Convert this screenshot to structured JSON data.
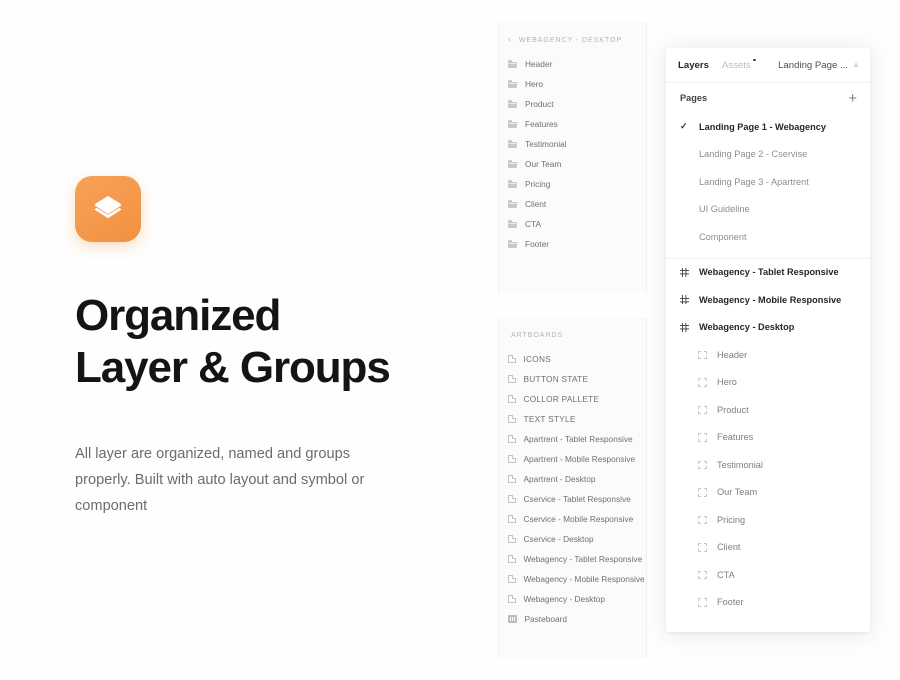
{
  "hero": {
    "logo_icon": "layers-stack-icon",
    "accent_color": "#F2913F",
    "title_line1": "Organized",
    "title_line2": "Layer & Groups",
    "body": "All layer are organized, named and groups properly. Built with auto layout and symbol or component"
  },
  "layers_panel": {
    "back_icon": "chevron-left-icon",
    "header": "WEBAGENCY - DESKTOP",
    "items": [
      {
        "label": "Header",
        "icon": "folder-icon"
      },
      {
        "label": "Hero",
        "icon": "folder-icon"
      },
      {
        "label": "Product",
        "icon": "folder-icon"
      },
      {
        "label": "Features",
        "icon": "folder-icon"
      },
      {
        "label": "Testimonial",
        "icon": "folder-icon"
      },
      {
        "label": "Our Team",
        "icon": "folder-icon"
      },
      {
        "label": "Pricing",
        "icon": "folder-icon"
      },
      {
        "label": "Client",
        "icon": "folder-icon"
      },
      {
        "label": "CTA",
        "icon": "folder-icon"
      },
      {
        "label": "Footer",
        "icon": "folder-icon"
      }
    ]
  },
  "artboards_panel": {
    "header": "ARTBOARDS",
    "items": [
      {
        "label": "ICONS",
        "icon": "artboard-icon",
        "caps": true
      },
      {
        "label": "BUTTON STATE",
        "icon": "artboard-icon",
        "caps": true
      },
      {
        "label": "COLLOR PALLETE",
        "icon": "artboard-icon",
        "caps": true
      },
      {
        "label": "TEXT STYLE",
        "icon": "artboard-icon",
        "caps": true
      },
      {
        "label": "Apartrent - Tablet Responsive",
        "icon": "artboard-icon",
        "caps": false
      },
      {
        "label": "Apartrent - Mobile Responsive",
        "icon": "artboard-icon",
        "caps": false
      },
      {
        "label": "Apartrent - Desktop",
        "icon": "artboard-icon",
        "caps": false
      },
      {
        "label": "Cservice - Tablet Responsive",
        "icon": "artboard-icon",
        "caps": false
      },
      {
        "label": "Cservice - Mobile Responsive",
        "icon": "artboard-icon",
        "caps": false
      },
      {
        "label": "Cservice - Desktop",
        "icon": "artboard-icon",
        "caps": false
      },
      {
        "label": "Webagency - Tablet Responsive",
        "icon": "artboard-icon",
        "caps": false
      },
      {
        "label": "Webagency - Mobile Responsive",
        "icon": "artboard-icon",
        "caps": false
      },
      {
        "label": "Webagency - Desktop",
        "icon": "artboard-icon",
        "caps": false
      },
      {
        "label": "Pasteboard",
        "icon": "pasteboard-icon",
        "caps": false
      }
    ]
  },
  "inspector": {
    "tabs": [
      {
        "label": "Layers",
        "active": true,
        "badge": false
      },
      {
        "label": "Assets",
        "active": false,
        "badge": true
      }
    ],
    "document_selector": {
      "label": "Landing Page ...",
      "caret_icon": "chevron-up-icon"
    },
    "pages_section": {
      "title": "Pages",
      "add_icon": "plus-icon",
      "check_icon": "check-icon",
      "items": [
        {
          "label": "Landing Page 1 - Webagency",
          "selected": true
        },
        {
          "label": "Landing Page 2 - Cservise",
          "selected": false
        },
        {
          "label": "Landing Page 3 - Apartrent",
          "selected": false
        },
        {
          "label": "UI Guideline",
          "selected": false
        },
        {
          "label": "Component",
          "selected": false
        }
      ]
    },
    "layers_section": {
      "artboards": [
        {
          "label": "Webagency - Tablet Responsive",
          "icon": "hash-artboard-icon"
        },
        {
          "label": "Webagency - Mobile Responsive",
          "icon": "hash-artboard-icon"
        },
        {
          "label": "Webagency - Desktop",
          "icon": "hash-artboard-icon"
        }
      ],
      "children": [
        {
          "label": "Header",
          "icon": "group-icon"
        },
        {
          "label": "Hero",
          "icon": "group-icon"
        },
        {
          "label": "Product",
          "icon": "group-icon"
        },
        {
          "label": "Features",
          "icon": "group-icon"
        },
        {
          "label": "Testimonial",
          "icon": "group-icon"
        },
        {
          "label": "Our Team",
          "icon": "group-icon"
        },
        {
          "label": "Pricing",
          "icon": "group-icon"
        },
        {
          "label": "Client",
          "icon": "group-icon"
        },
        {
          "label": "CTA",
          "icon": "group-icon"
        },
        {
          "label": "Footer",
          "icon": "group-icon"
        }
      ]
    }
  }
}
